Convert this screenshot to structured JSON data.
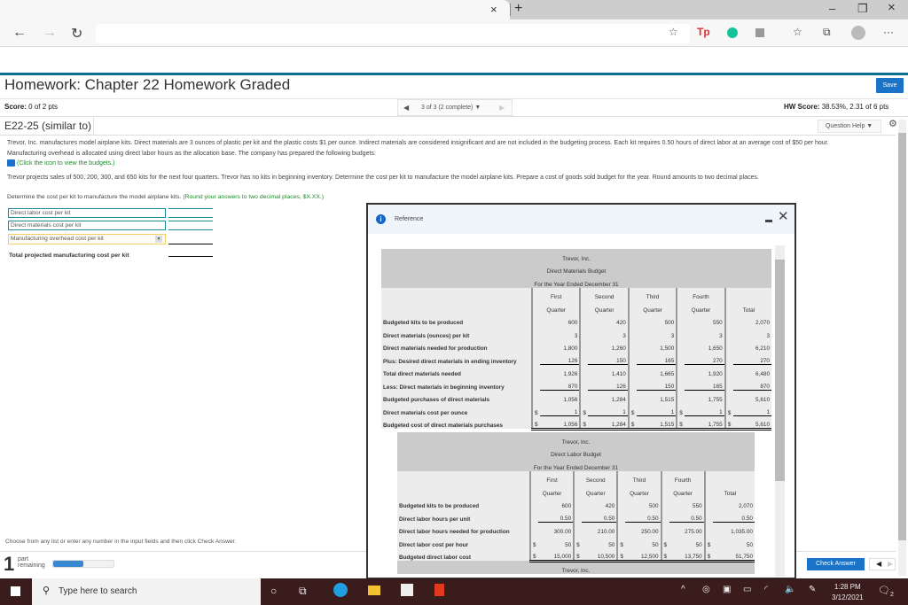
{
  "browser": {
    "tab_close": "×",
    "new_tab": "+",
    "minimize": "–",
    "maximize": "❐",
    "close": "×",
    "back_icon": "←",
    "forward_icon": "→",
    "refresh_icon": "↻",
    "more_icon": "···",
    "favorites_icon": "☆",
    "collections_icon": "⧉"
  },
  "page": {
    "title": "Homework: Chapter 22 Homework Graded",
    "save_label": "Save",
    "score_label": "Score:",
    "score_value": "0 of 2 pts",
    "question_nav": "3 of 3 (2 complete)",
    "hw_score_label": "HW Score:",
    "hw_score_value": "38.53%, 2.31 of 6 pts",
    "question_id": "E22-25 (similar to)",
    "question_help": "Question Help",
    "problem_text_1": "Trevor, Inc. manufactures model airplane kits. Direct materials are 3 ounces of plastic per kit and the plastic costs $1 per ounce. Indirect materials are considered insignificant and are not included in the budgeting process. Each kit requires 0.50 hours of direct labor at an average cost of $50 per hour.",
    "problem_text_2": "Manufacturing overhead is allocated using direct labor hours as the allocation base. The company has prepared the following budgets:",
    "budget_link": "(Click the icon to view the budgets.)",
    "problem_text_3": "Trevor projects sales of 500, 200, 300, and 650 kits for the next four quarters. Trevor has no kits in beginning inventory. Determine the cost per kit to manufacture the model airplane kits. Prepare a cost of goods sold budget for the year. Round amounts to two decimal places.",
    "instruction": "Determine the cost per kit to manufacture the model airplane kits.",
    "instruction_hint": "(Round your answers to two decimal places, $X.XX.)",
    "answer_rows": [
      "Direct labor cost per kit",
      "Direct materials cost per kit",
      "Manufacturing overhead cost per kit"
    ],
    "answer_total_label": "Total projected manufacturing cost per kit",
    "choose_text": "Choose from any list or enter any number in the input fields and then click Check Answer.",
    "parts_remaining_num": "1",
    "parts_remaining_word1": "part",
    "parts_remaining_word2": "remaining",
    "progress_fraction": 0.5,
    "check_answer": "Check Answer"
  },
  "modal": {
    "title": "Reference",
    "materials": {
      "company": "Trevor, Inc.",
      "name": "Direct Materials Budget",
      "period": "For the Year Ended December 31",
      "cols_top": [
        "First",
        "Second",
        "Third",
        "Fourth",
        ""
      ],
      "cols_bottom": [
        "Quarter",
        "Quarter",
        "Quarter",
        "Quarter",
        "Total"
      ],
      "rows": [
        {
          "label": "Budgeted kits to be produced",
          "values": [
            "600",
            "420",
            "500",
            "550",
            "2,070"
          ]
        },
        {
          "label": "Direct materials (ounces) per kit",
          "values": [
            "3",
            "3",
            "3",
            "3",
            "3"
          ]
        },
        {
          "label": "Direct materials needed for production",
          "values": [
            "1,800",
            "1,260",
            "1,500",
            "1,650",
            "6,210"
          ]
        },
        {
          "label": "Plus: Desired direct materials in ending inventory",
          "values": [
            "126",
            "150",
            "165",
            "270",
            "270"
          ]
        },
        {
          "label": "Total direct materials needed",
          "values": [
            "1,926",
            "1,410",
            "1,665",
            "1,920",
            "6,480"
          ]
        },
        {
          "label": "Less: Direct materials in beginning inventory",
          "values": [
            "870",
            "126",
            "150",
            "165",
            "870"
          ]
        },
        {
          "label": "Budgeted purchases of direct materials",
          "values": [
            "1,056",
            "1,284",
            "1,515",
            "1,755",
            "5,610"
          ]
        },
        {
          "label": "Direct materials cost per ounce",
          "values": [
            "1",
            "1",
            "1",
            "1",
            "1"
          ]
        },
        {
          "label": "Budgeted cost of direct materials purchases",
          "values": [
            "1,056",
            "1,284",
            "1,515",
            "1,755",
            "5,610"
          ]
        }
      ]
    },
    "labor": {
      "company": "Trevor, Inc.",
      "name": "Direct Labor Budget",
      "period": "For the Year Ended December 31",
      "cols_top": [
        "First",
        "Second",
        "Third",
        "Fourth",
        ""
      ],
      "cols_bottom": [
        "Quarter",
        "Quarter",
        "Quarter",
        "Quarter",
        "Total"
      ],
      "rows": [
        {
          "label": "Budgeted kits to be produced",
          "values": [
            "600",
            "420",
            "500",
            "550",
            "2,070"
          ]
        },
        {
          "label": "Direct labor hours per unit",
          "values": [
            "0.50",
            "0.50",
            "0.50",
            "0.50",
            "0.50"
          ]
        },
        {
          "label": "Direct labor hours needed for production",
          "values": [
            "300.00",
            "210.00",
            "250.00",
            "275.00",
            "1,035.00"
          ]
        },
        {
          "label": "Direct labor cost per hour",
          "values": [
            "50",
            "50",
            "50",
            "50",
            "50"
          ]
        },
        {
          "label": "Budgeted direct labor cost",
          "values": [
            "15,000",
            "10,500",
            "12,500",
            "13,750",
            "51,750"
          ]
        }
      ]
    },
    "next_company": "Trevor, Inc.",
    "dollar": "$"
  },
  "taskbar": {
    "search_placeholder": "Type here to search",
    "time": "1:28 PM",
    "date": "3/12/2021",
    "notifications": "2"
  }
}
